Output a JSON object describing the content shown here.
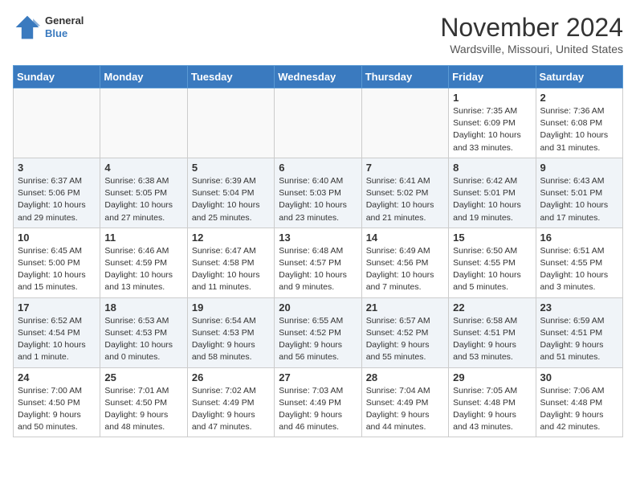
{
  "header": {
    "logo_line1": "General",
    "logo_line2": "Blue",
    "month": "November 2024",
    "location": "Wardsville, Missouri, United States"
  },
  "days_of_week": [
    "Sunday",
    "Monday",
    "Tuesday",
    "Wednesday",
    "Thursday",
    "Friday",
    "Saturday"
  ],
  "weeks": [
    [
      {
        "day": "",
        "info": ""
      },
      {
        "day": "",
        "info": ""
      },
      {
        "day": "",
        "info": ""
      },
      {
        "day": "",
        "info": ""
      },
      {
        "day": "",
        "info": ""
      },
      {
        "day": "1",
        "info": "Sunrise: 7:35 AM\nSunset: 6:09 PM\nDaylight: 10 hours and 33 minutes."
      },
      {
        "day": "2",
        "info": "Sunrise: 7:36 AM\nSunset: 6:08 PM\nDaylight: 10 hours and 31 minutes."
      }
    ],
    [
      {
        "day": "3",
        "info": "Sunrise: 6:37 AM\nSunset: 5:06 PM\nDaylight: 10 hours and 29 minutes."
      },
      {
        "day": "4",
        "info": "Sunrise: 6:38 AM\nSunset: 5:05 PM\nDaylight: 10 hours and 27 minutes."
      },
      {
        "day": "5",
        "info": "Sunrise: 6:39 AM\nSunset: 5:04 PM\nDaylight: 10 hours and 25 minutes."
      },
      {
        "day": "6",
        "info": "Sunrise: 6:40 AM\nSunset: 5:03 PM\nDaylight: 10 hours and 23 minutes."
      },
      {
        "day": "7",
        "info": "Sunrise: 6:41 AM\nSunset: 5:02 PM\nDaylight: 10 hours and 21 minutes."
      },
      {
        "day": "8",
        "info": "Sunrise: 6:42 AM\nSunset: 5:01 PM\nDaylight: 10 hours and 19 minutes."
      },
      {
        "day": "9",
        "info": "Sunrise: 6:43 AM\nSunset: 5:01 PM\nDaylight: 10 hours and 17 minutes."
      }
    ],
    [
      {
        "day": "10",
        "info": "Sunrise: 6:45 AM\nSunset: 5:00 PM\nDaylight: 10 hours and 15 minutes."
      },
      {
        "day": "11",
        "info": "Sunrise: 6:46 AM\nSunset: 4:59 PM\nDaylight: 10 hours and 13 minutes."
      },
      {
        "day": "12",
        "info": "Sunrise: 6:47 AM\nSunset: 4:58 PM\nDaylight: 10 hours and 11 minutes."
      },
      {
        "day": "13",
        "info": "Sunrise: 6:48 AM\nSunset: 4:57 PM\nDaylight: 10 hours and 9 minutes."
      },
      {
        "day": "14",
        "info": "Sunrise: 6:49 AM\nSunset: 4:56 PM\nDaylight: 10 hours and 7 minutes."
      },
      {
        "day": "15",
        "info": "Sunrise: 6:50 AM\nSunset: 4:55 PM\nDaylight: 10 hours and 5 minutes."
      },
      {
        "day": "16",
        "info": "Sunrise: 6:51 AM\nSunset: 4:55 PM\nDaylight: 10 hours and 3 minutes."
      }
    ],
    [
      {
        "day": "17",
        "info": "Sunrise: 6:52 AM\nSunset: 4:54 PM\nDaylight: 10 hours and 1 minute."
      },
      {
        "day": "18",
        "info": "Sunrise: 6:53 AM\nSunset: 4:53 PM\nDaylight: 10 hours and 0 minutes."
      },
      {
        "day": "19",
        "info": "Sunrise: 6:54 AM\nSunset: 4:53 PM\nDaylight: 9 hours and 58 minutes."
      },
      {
        "day": "20",
        "info": "Sunrise: 6:55 AM\nSunset: 4:52 PM\nDaylight: 9 hours and 56 minutes."
      },
      {
        "day": "21",
        "info": "Sunrise: 6:57 AM\nSunset: 4:52 PM\nDaylight: 9 hours and 55 minutes."
      },
      {
        "day": "22",
        "info": "Sunrise: 6:58 AM\nSunset: 4:51 PM\nDaylight: 9 hours and 53 minutes."
      },
      {
        "day": "23",
        "info": "Sunrise: 6:59 AM\nSunset: 4:51 PM\nDaylight: 9 hours and 51 minutes."
      }
    ],
    [
      {
        "day": "24",
        "info": "Sunrise: 7:00 AM\nSunset: 4:50 PM\nDaylight: 9 hours and 50 minutes."
      },
      {
        "day": "25",
        "info": "Sunrise: 7:01 AM\nSunset: 4:50 PM\nDaylight: 9 hours and 48 minutes."
      },
      {
        "day": "26",
        "info": "Sunrise: 7:02 AM\nSunset: 4:49 PM\nDaylight: 9 hours and 47 minutes."
      },
      {
        "day": "27",
        "info": "Sunrise: 7:03 AM\nSunset: 4:49 PM\nDaylight: 9 hours and 46 minutes."
      },
      {
        "day": "28",
        "info": "Sunrise: 7:04 AM\nSunset: 4:49 PM\nDaylight: 9 hours and 44 minutes."
      },
      {
        "day": "29",
        "info": "Sunrise: 7:05 AM\nSunset: 4:48 PM\nDaylight: 9 hours and 43 minutes."
      },
      {
        "day": "30",
        "info": "Sunrise: 7:06 AM\nSunset: 4:48 PM\nDaylight: 9 hours and 42 minutes."
      }
    ]
  ]
}
